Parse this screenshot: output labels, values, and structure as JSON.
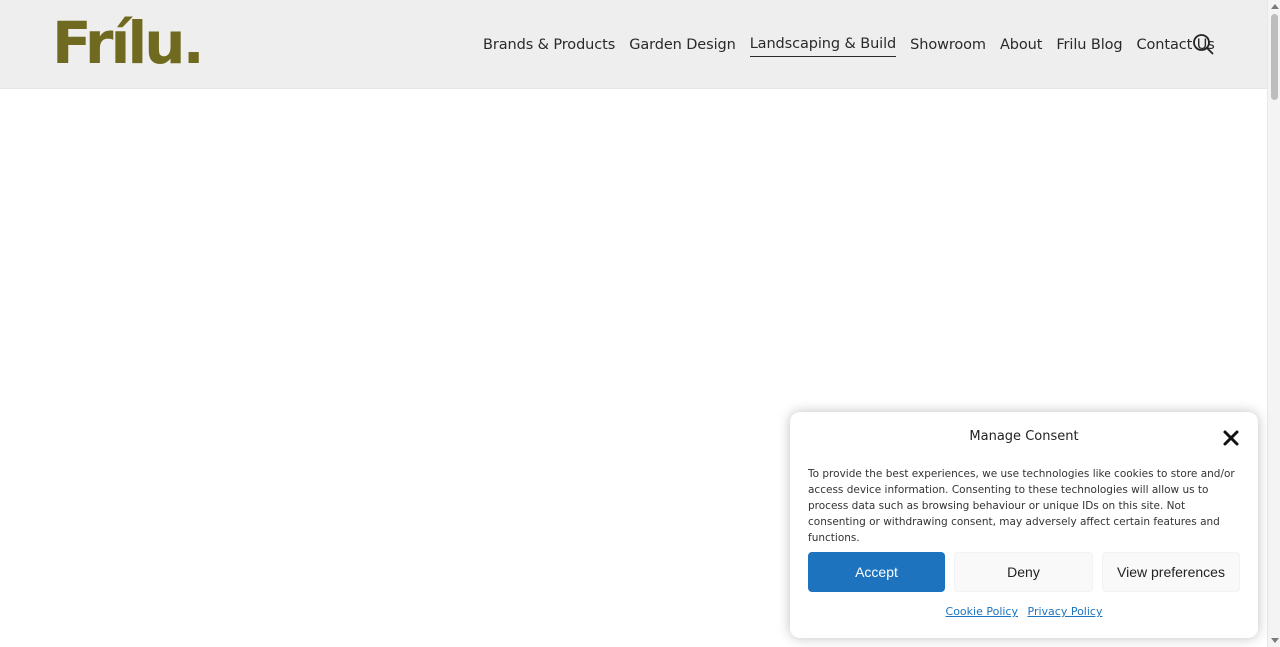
{
  "header": {
    "logo_text": "Frílu.",
    "brand_color": "#6f6a1f",
    "nav": [
      {
        "label": "Brands & Products",
        "active": false
      },
      {
        "label": "Garden Design",
        "active": false
      },
      {
        "label": "Landscaping & Build",
        "active": true
      },
      {
        "label": "Showroom",
        "active": false
      },
      {
        "label": "About",
        "active": false
      },
      {
        "label": "Frilu Blog",
        "active": false
      },
      {
        "label": "Contact Us",
        "active": false
      }
    ],
    "search_icon": "search-icon"
  },
  "consent": {
    "title": "Manage Consent",
    "close_icon": "close-icon",
    "body": "To provide the best experiences, we use technologies like cookies to store and/or access device information. Consenting to these technologies will allow us to process data such as browsing behaviour or unique IDs on this site. Not consenting or withdrawing consent, may adversely affect certain features and functions.",
    "accept_label": "Accept",
    "deny_label": "Deny",
    "preferences_label": "View preferences",
    "cookie_policy_label": "Cookie Policy",
    "privacy_policy_label": "Privacy Policy",
    "accent_color": "#1e73be"
  }
}
